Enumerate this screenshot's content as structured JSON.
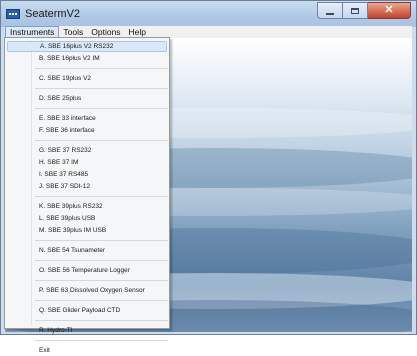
{
  "window": {
    "title": "SeatermV2"
  },
  "menubar": [
    "Instruments",
    "Tools",
    "Options",
    "Help"
  ],
  "dropdown": {
    "groups": [
      [
        "A. SBE 16plus V2 RS232",
        "B. SBE 16plus V2 IM"
      ],
      [
        "C. SBE 19plus V2"
      ],
      [
        "D. SBE 25plus"
      ],
      [
        "E. SBE 33 interface",
        "F. SBE 36 interface"
      ],
      [
        "G. SBE 37 RS232",
        "H. SBE 37 IM",
        "I. SBE 37 RS485",
        "J. SBE 37 SDI-12"
      ],
      [
        "K. SBE 39plus RS232",
        "L. SBE 39plus USB",
        "M. SBE 39plus IM USB"
      ],
      [
        "N. SBE 54 Tsunameter"
      ],
      [
        "O. SBE 56 Temperature Logger"
      ],
      [
        "P. SBE 63 Dissolved Oxygen Sensor"
      ],
      [
        "Q. SBE Glider Payload CTD"
      ],
      [
        "R. Hydro-TI"
      ],
      [
        "Exit"
      ]
    ],
    "highlighted_index": 0
  }
}
